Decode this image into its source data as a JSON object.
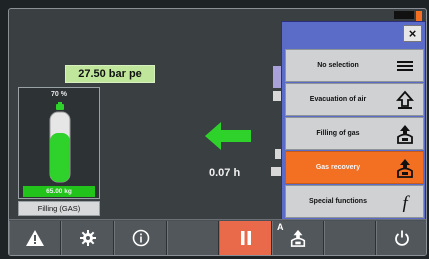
{
  "status": {
    "pressure": "27.50 bar pe",
    "flow_time": "0.07 h"
  },
  "cylinder": {
    "fill_percent_label": "70 %",
    "fill_level": 0.7,
    "weight_label": "65.00 kg",
    "mode_label": "Filling (GAS)"
  },
  "menu": {
    "close_label": "×",
    "items": [
      {
        "label": "No selection",
        "icon": "menu-lines-icon",
        "active": false
      },
      {
        "label": "Evacuation of air",
        "icon": "outline-arrow-up-icon",
        "active": false
      },
      {
        "label": "Filling of gas",
        "icon": "cylinder-arrow-in-icon",
        "active": false
      },
      {
        "label": "Gas recovery",
        "icon": "cylinder-arrow-out-icon",
        "active": true
      },
      {
        "label": "Special functions",
        "icon": "function-f-icon",
        "active": false
      }
    ]
  },
  "toolbar": {
    "auto_label": "A",
    "buttons": [
      "warning-icon",
      "gear-icon",
      "info-icon",
      "blank",
      "pause-icon",
      "auto-mode-icon",
      "blank",
      "power-icon"
    ]
  },
  "colors": {
    "accent_orange": "#f36f21",
    "readout_green": "#bfe69a",
    "cylinder_green": "#22c31b",
    "menu_header_blue": "#5b6bc8",
    "pause_red": "#e86a4a"
  }
}
